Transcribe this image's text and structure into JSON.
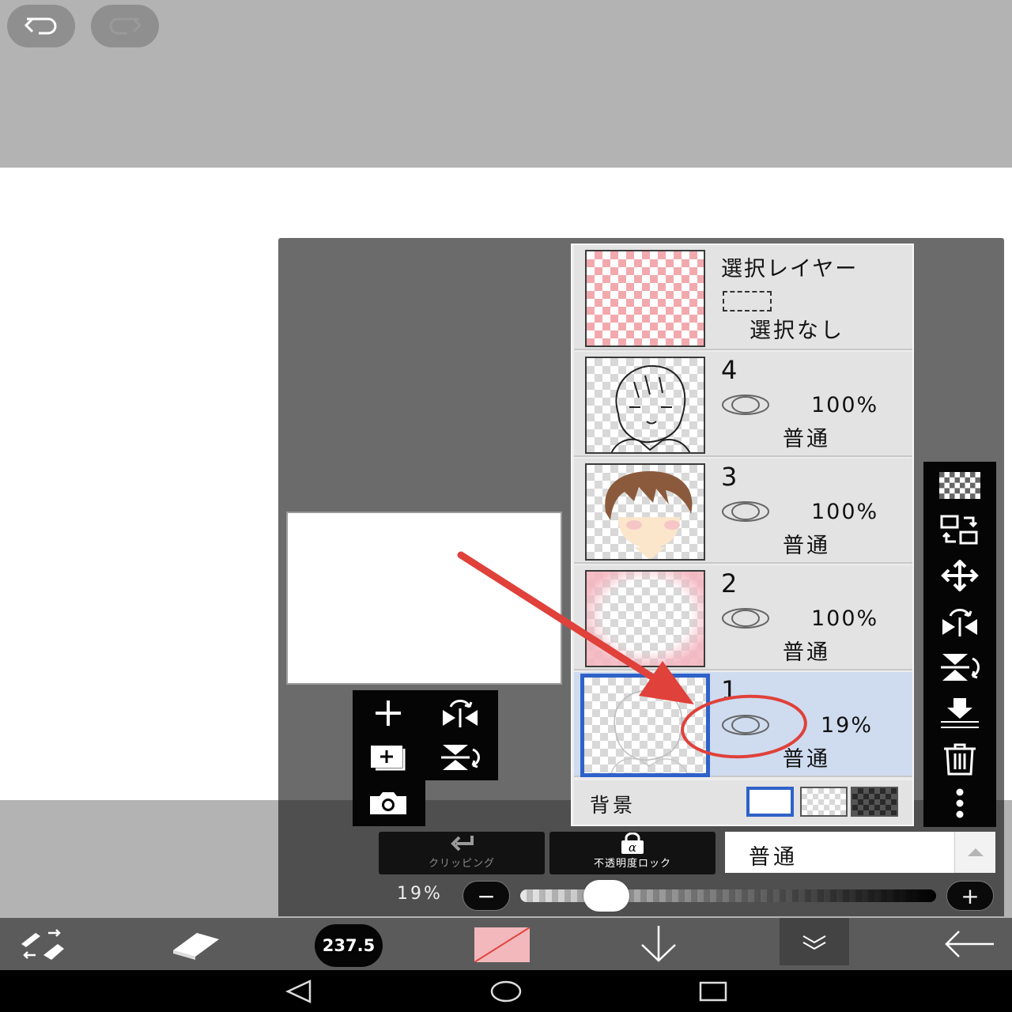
{
  "layers": {
    "selection": {
      "title": "選択レイヤー",
      "status": "選択なし"
    },
    "items": [
      {
        "number": "4",
        "opacity": "100%",
        "mode": "普通"
      },
      {
        "number": "3",
        "opacity": "100%",
        "mode": "普通"
      },
      {
        "number": "2",
        "opacity": "100%",
        "mode": "普通"
      },
      {
        "number": "1",
        "opacity": "19%",
        "mode": "普通",
        "selected": true
      }
    ],
    "background_label": "背景"
  },
  "options": {
    "clipping_label": "クリッピング",
    "alpha_lock_label": "不透明度ロック",
    "blend_mode": "普通"
  },
  "opacity_slider": {
    "label": "19%",
    "value": 0.19,
    "minus": "−",
    "plus": "+"
  },
  "brush": {
    "size": "237.5"
  },
  "colors": {
    "panel": "#6b6b6b",
    "selected_layer": "#cfdcf0",
    "selected_border": "#2f62c9",
    "annotation_red": "#e0413a",
    "brush_color": "#f2b8bc"
  },
  "icons": {
    "top": [
      "undo-icon",
      "redo-icon"
    ],
    "right_toolbar": [
      "transparency-icon",
      "layer-swap-icon",
      "move-icon",
      "flip-horizontal-icon",
      "flip-vertical-icon",
      "merge-down-icon",
      "trash-icon",
      "more-icon"
    ],
    "float_tools": [
      "add-layer-icon",
      "flip-horizontal-icon",
      "add-layer-copy-icon",
      "flip-vertical-icon",
      "camera-icon"
    ],
    "bottom_bar": [
      "tool-swap-icon",
      "eraser-icon",
      "brush-size-icon",
      "color-icon",
      "download-icon",
      "chevron-down-icon",
      "back-arrow-icon"
    ],
    "nav": [
      "nav-back-icon",
      "nav-home-icon",
      "nav-recent-icon"
    ]
  }
}
